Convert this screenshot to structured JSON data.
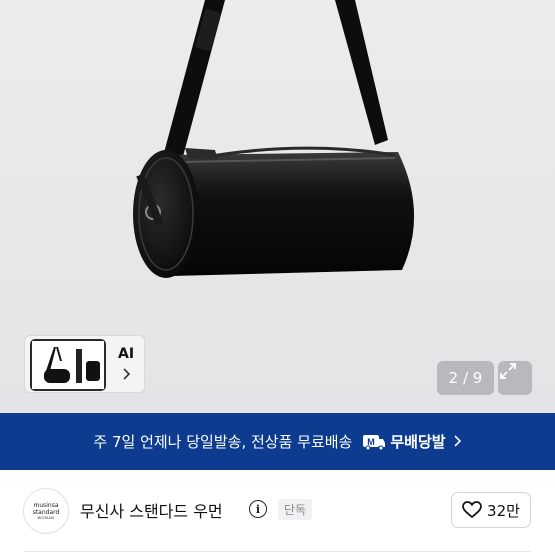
{
  "gallery": {
    "ai_label": "AI",
    "counter": "2 / 9",
    "chevron_icon": "chevron-right-icon",
    "expand_icon": "expand-icon"
  },
  "banner": {
    "message": "주 7일 언제나 당일발송, 전상품 무료배송",
    "badge_icon": "musinsa-delivery-icon",
    "brand": "무배당발",
    "background": "#0c3b8f"
  },
  "brand": {
    "logo_line1": "musinsa",
    "logo_line2": "standard",
    "logo_line3": "WOMAN",
    "name": "무신사 스탠다드 우먼",
    "tag": "단독",
    "like_count": "32만",
    "like_icon": "heart-icon"
  }
}
